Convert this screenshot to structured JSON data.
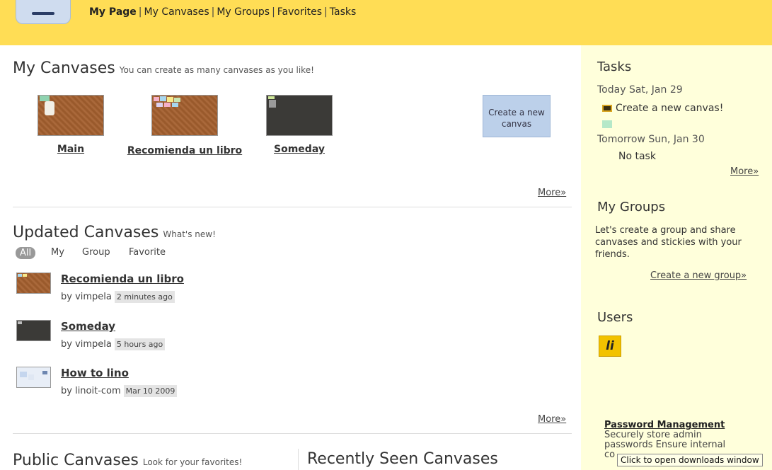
{
  "nav": {
    "items": [
      "My Page",
      "My Canvases",
      "My Groups",
      "Favorites",
      "Tasks"
    ],
    "separator": "|"
  },
  "my_canvases": {
    "title": "My Canvases",
    "subtitle": "You can create as many canvases as you like!",
    "canvases": [
      {
        "label": "Main"
      },
      {
        "label": "Recomienda un libro"
      },
      {
        "label": "Someday"
      }
    ],
    "create_label": "Create a new canvas",
    "more": "More»"
  },
  "updated": {
    "title": "Updated Canvases",
    "subtitle": "What's new!",
    "filters": [
      "All",
      "My",
      "Group",
      "Favorite"
    ],
    "items": [
      {
        "title": "Recomienda un libro",
        "by": "by vimpela",
        "time": "2 minutes ago"
      },
      {
        "title": "Someday",
        "by": "by vimpela",
        "time": "5 hours ago"
      },
      {
        "title": "How to lino",
        "by": "by linoit-com",
        "time": "Mar 10 2009"
      }
    ],
    "more": "More»"
  },
  "public": {
    "title": "Public Canvases",
    "subtitle": "Look for your favorites!"
  },
  "recent": {
    "title": "Recently Seen Canvases"
  },
  "sidebar": {
    "tasks_title": "Tasks",
    "today": "Today Sat, Jan 29",
    "task_item": "Create a new canvas!",
    "tomorrow": "Tomorrow Sun, Jan 30",
    "no_task": "No task",
    "tasks_more": "More»",
    "groups_title": "My Groups",
    "groups_text": "Let's create a group and share canvases and stickies with your friends.",
    "create_group": "Create a new group»",
    "users_title": "Users",
    "user_avatar": "li"
  },
  "ad": {
    "title": "Password Management",
    "line1": "Securely store admin",
    "line2": "passwords Ensure internal",
    "line3": "co"
  },
  "tooltip": "Click to open downloads window",
  "colors": {
    "topbar": "#ffdd55",
    "sidebar": "#ffffdb",
    "create_button": "#bcd0ea"
  }
}
